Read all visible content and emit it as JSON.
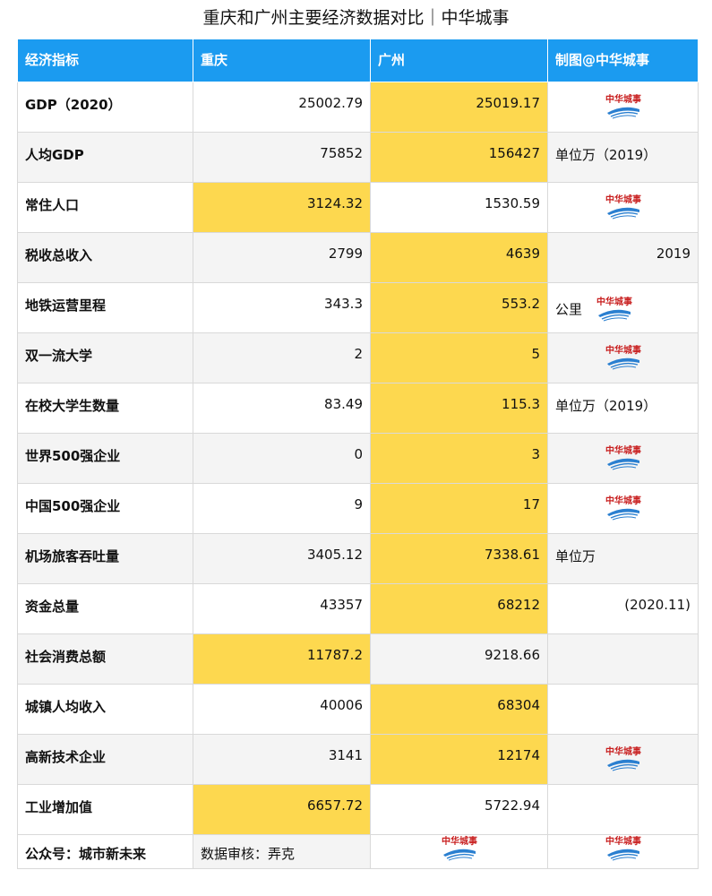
{
  "title": "重庆和广州主要经济数据对比｜中华城事",
  "brand_text": "中华城事",
  "colors": {
    "header_bg": "#1b9bf0",
    "highlight": "#fdd84f",
    "brand_red": "#c81e1e",
    "train_blue": "#2a7fd0"
  },
  "header": [
    "经济指标",
    "重庆",
    "广州",
    "制图@中华城事"
  ],
  "rows": [
    {
      "label": "GDP（2020）",
      "cq": "25002.79",
      "gz": "25019.17",
      "hl": "gz",
      "note": "",
      "note_align": "left",
      "logo": "center"
    },
    {
      "label": "人均GDP",
      "cq": "75852",
      "gz": "156427",
      "hl": "gz",
      "note": "单位万（2019）",
      "note_align": "left",
      "logo": "none"
    },
    {
      "label": "常住人口",
      "cq": "3124.32",
      "gz": "1530.59",
      "hl": "cq",
      "note": "",
      "note_align": "left",
      "logo": "center"
    },
    {
      "label": "税收总收入",
      "cq": "2799",
      "gz": "4639",
      "hl": "gz",
      "note": "2019",
      "note_align": "right",
      "logo": "none"
    },
    {
      "label": "地铁运营里程",
      "cq": "343.3",
      "gz": "553.2",
      "hl": "gz",
      "note": "公里",
      "note_align": "left",
      "logo": "inline"
    },
    {
      "label": "双一流大学",
      "cq": "2",
      "gz": "5",
      "hl": "gz",
      "note": "",
      "note_align": "left",
      "logo": "center"
    },
    {
      "label": "在校大学生数量",
      "cq": "83.49",
      "gz": "115.3",
      "hl": "gz",
      "note": "单位万（2019）",
      "note_align": "left",
      "logo": "none"
    },
    {
      "label": "世界500强企业",
      "cq": "0",
      "gz": "3",
      "hl": "gz",
      "note": "",
      "note_align": "left",
      "logo": "center"
    },
    {
      "label": "中国500强企业",
      "cq": "9",
      "gz": "17",
      "hl": "gz",
      "note": "",
      "note_align": "left",
      "logo": "center"
    },
    {
      "label": "机场旅客吞吐量",
      "cq": "3405.12",
      "gz": "7338.61",
      "hl": "gz",
      "note": "单位万",
      "note_align": "left",
      "logo": "none"
    },
    {
      "label": "资金总量",
      "cq": "43357",
      "gz": "68212",
      "hl": "gz",
      "note": "(2020.11)",
      "note_align": "right",
      "logo": "none"
    },
    {
      "label": "社会消费总额",
      "cq": "11787.2",
      "gz": "9218.66",
      "hl": "cq",
      "note": "",
      "note_align": "left",
      "logo": "none"
    },
    {
      "label": "城镇人均收入",
      "cq": "40006",
      "gz": "68304",
      "hl": "gz",
      "note": "",
      "note_align": "left",
      "logo": "none"
    },
    {
      "label": "高新技术企业",
      "cq": "3141",
      "gz": "12174",
      "hl": "gz",
      "note": "",
      "note_align": "left",
      "logo": "center"
    },
    {
      "label": "工业增加值",
      "cq": "6657.72",
      "gz": "5722.94",
      "hl": "cq",
      "note": "",
      "note_align": "left",
      "logo": "none"
    }
  ],
  "footer": {
    "c1": "公众号：城市新未来",
    "c2": "数据审核：弄克"
  }
}
